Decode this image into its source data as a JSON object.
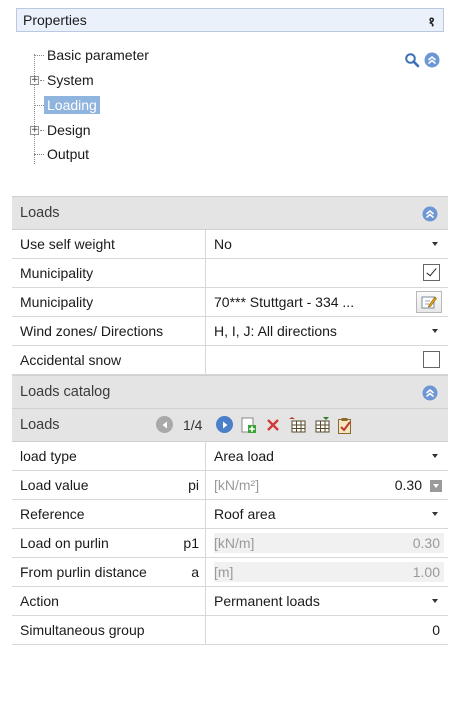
{
  "panel": {
    "title": "Properties",
    "pin_glyph": "१"
  },
  "tree": {
    "items": [
      {
        "label": "Basic parameter",
        "expandable": false,
        "selected": false
      },
      {
        "label": "System",
        "expandable": true,
        "selected": false
      },
      {
        "label": "Loading",
        "expandable": false,
        "selected": true
      },
      {
        "label": "Design",
        "expandable": true,
        "selected": false
      },
      {
        "label": "Output",
        "expandable": false,
        "selected": false
      }
    ],
    "expander_glyph": "+"
  },
  "loads": {
    "header": "Loads",
    "rows": [
      {
        "label": "Use self weight",
        "value": "No",
        "control": "dropdown"
      },
      {
        "label": "Municipality",
        "value": "",
        "control": "checkbox",
        "checked": true
      },
      {
        "label": "Municipality",
        "value": "70*** Stuttgart - 334 ...",
        "control": "edit-button"
      },
      {
        "label": "Wind zones/ Directions",
        "value": "H, I, J: All directions",
        "control": "dropdown"
      },
      {
        "label": "Accidental snow",
        "value": "",
        "control": "checkbox",
        "checked": false
      }
    ]
  },
  "catalog": {
    "header": "Loads catalog",
    "toolbar_label": "Loads",
    "page_indicator": "1/4",
    "rows": [
      {
        "label": "load type",
        "value": "Area load",
        "control": "dropdown"
      },
      {
        "label": "Load value",
        "symbol": "pi",
        "unit": "[kN/m²]",
        "value": "0.30",
        "control": "spin"
      },
      {
        "label": "Reference",
        "value": "Roof area",
        "control": "dropdown"
      },
      {
        "label": "Load on purlin",
        "symbol": "p1",
        "unit": "[kN/m]",
        "value": "0.30",
        "control": "readonly"
      },
      {
        "label": "From purlin distance",
        "symbol": "a",
        "unit": "[m]",
        "value": "1.00",
        "control": "readonly"
      },
      {
        "label": "Action",
        "value": "Permanent loads",
        "control": "dropdown"
      },
      {
        "label": "Simultaneous group",
        "value": "0",
        "control": "number"
      }
    ]
  },
  "colors": {
    "accent_blue": "#4a7fc9",
    "selection": "#8fb4de",
    "header_gray": "#e4e4e4",
    "add_green": "#3aa43a",
    "delete_red": "#d03a3a"
  },
  "icons": [
    "pin-icon",
    "search-icon",
    "collapse-up-icon",
    "nav-prev-icon",
    "nav-next-icon",
    "add-icon",
    "delete-icon",
    "table-import-icon",
    "table-export-icon",
    "clipboard-check-icon",
    "edit-icon"
  ]
}
